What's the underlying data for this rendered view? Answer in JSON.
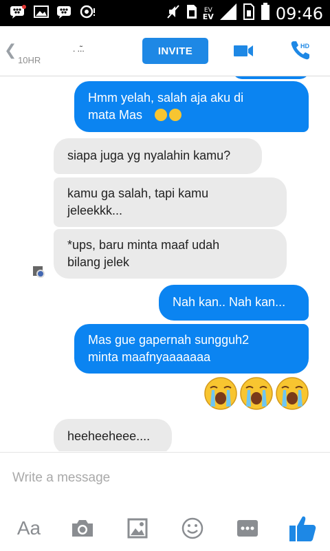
{
  "status_bar": {
    "time": "09:46",
    "network_label": "EV",
    "network_label_2": "EV",
    "notification_icons": [
      "bbm-notification-icon",
      "gallery-icon",
      "bbm-icon",
      "voicemail-icon"
    ]
  },
  "header": {
    "back_label": "10HR",
    "contact_name": ". .̃..",
    "invite_label": "INVITE",
    "call_badge": "HD"
  },
  "messages": [
    {
      "dir": "out",
      "text": "Hmm yelah, salah aja aku di mata Mas",
      "emoji": [
        "pensive",
        "pensive"
      ]
    },
    {
      "dir": "in",
      "text": "siapa juga yg nyalahin kamu?"
    },
    {
      "dir": "in",
      "text": "kamu ga salah, tapi kamu jeleekkk..."
    },
    {
      "dir": "in",
      "text": "*ups, baru minta maaf udah bilang jelek"
    },
    {
      "dir": "out",
      "text": "Nah kan.. Nah kan..."
    },
    {
      "dir": "out",
      "text": "Mas gue gapernah sungguh2 minta maafnyaaaaaaa"
    },
    {
      "dir": "out",
      "type": "emoji",
      "emoji": [
        "loudly-crying",
        "loudly-crying",
        "loudly-crying"
      ]
    },
    {
      "dir": "in",
      "text": "heeheeheee...."
    }
  ],
  "m0a": "Hmm yelah, salah aja aku di",
  "m0b": "mata Mas",
  "m2a": "kamu ga salah, tapi kamu",
  "m2b": "jeleekkk...",
  "m3a": "*ups, baru minta maaf udah",
  "m3b": "bilang jelek",
  "m5a": "Mas gue gapernah sungguh2",
  "m5b": "minta maafnyaaaaaaa",
  "compose": {
    "placeholder": "Write a message",
    "toolbar": [
      "Aa",
      "camera",
      "gallery",
      "emoji",
      "more",
      "like"
    ]
  },
  "colors": {
    "accent": "#0b84f1",
    "invite": "#1e88e5",
    "incoming_bubble": "#eaeaea",
    "like": "#1e88e5"
  }
}
